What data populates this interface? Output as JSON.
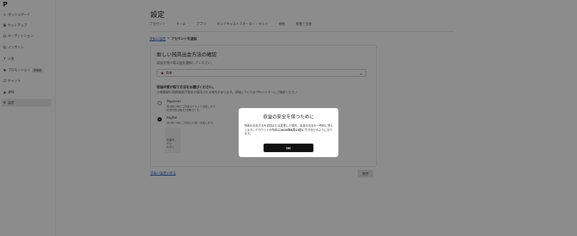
{
  "sidebar": {
    "logo": "P",
    "items": [
      {
        "icon": "⌂",
        "label": "ダッシュボード"
      },
      {
        "icon": "▣",
        "label": "セットアップ"
      },
      {
        "icon": "▤",
        "label": "キーディシション"
      },
      {
        "icon": "▥",
        "label": "インサイト"
      },
      {
        "icon": "¥",
        "label": "入金"
      },
      {
        "icon": "◆",
        "label": "プロモーション",
        "badge": "新機能"
      },
      {
        "icon": "☺",
        "label": "チャット"
      },
      {
        "icon": "▲",
        "label": "通知"
      },
      {
        "icon": "⚙",
        "label": "設定"
      }
    ]
  },
  "header": {
    "title": "設定",
    "tabs": [
      "アカウント",
      "チーム",
      "アプリ",
      "ポッドキャストスターター・キット",
      "規約",
      "税金と出金"
    ]
  },
  "breadcrumb": {
    "link": "支払い設定",
    "separator": ">",
    "current": "アカウントを追加"
  },
  "card": {
    "title": "新しい残高出金方法の確認",
    "region_prompt": "収益を受け取る国を選択してください。",
    "country": "日本",
    "methods_title": "収益の受け取り方法をお選びください。",
    "methods_desc": "小規模銀行/国際取扱手数料が適用される場合があります。詳細についてはプロバイダーにご確認ください",
    "options": [
      {
        "name": "Payoneer",
        "desc": "受け取り時にご所定のゲストへ送金します。",
        "desc2": "処理日数は最大7営業日です。",
        "selected": false
      },
      {
        "name": "PayPal",
        "desc": "受け取り時にご所定の口座へ送金します。",
        "selected": true
      }
    ],
    "info_lines": [
      "出金可",
      "テレ",
      "エダイ"
    ]
  },
  "footer": {
    "back_link": "支払い設定に戻る",
    "save_label": "保存"
  },
  "modal": {
    "title": "収益の安全を保つために",
    "body_part1": "残高の出金方法を追加または変更した場合、収益の出金を一時的に停止します。アカウントの残高は",
    "body_bold": "2025年8月13日",
    "body_part2": "に引き出せるようになります。",
    "ok_label": "OK"
  }
}
